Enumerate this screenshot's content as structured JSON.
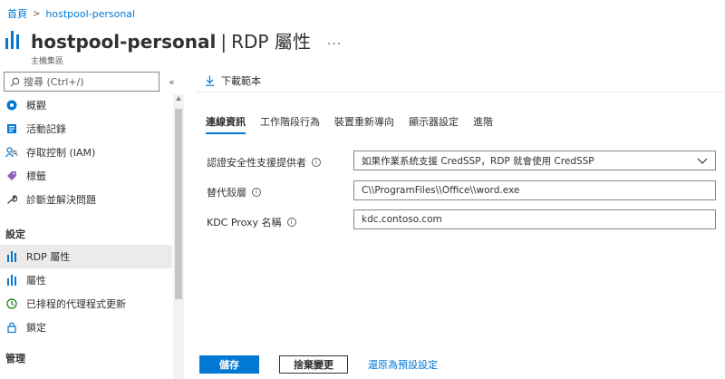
{
  "breadcrumb": {
    "home": "首頁",
    "current": "hostpool-personal"
  },
  "header": {
    "resource_name": "hostpool-personal",
    "separator": "|",
    "blade_title": "RDP 屬性",
    "more": "···",
    "subtitle": "主機集區"
  },
  "sidebar": {
    "search_placeholder": "搜尋 (Ctrl+/)",
    "collapse": "«",
    "items_top": [
      {
        "label": "概觀",
        "icon": "overview-icon"
      },
      {
        "label": "活動記錄",
        "icon": "activity-log-icon"
      },
      {
        "label": "存取控制 (IAM)",
        "icon": "iam-icon"
      },
      {
        "label": "標籤",
        "icon": "tag-icon"
      },
      {
        "label": "診斷並解決問題",
        "icon": "wrench-icon"
      }
    ],
    "section_settings": "設定",
    "items_settings": [
      {
        "label": "RDP 屬性",
        "icon": "hostpool-icon",
        "active": true
      },
      {
        "label": "屬性",
        "icon": "properties-icon"
      },
      {
        "label": "已排程的代理程式更新",
        "icon": "clock-icon"
      },
      {
        "label": "鎖定",
        "icon": "lock-icon"
      }
    ],
    "section_manage": "管理"
  },
  "toolbar": {
    "download_label": "下載範本"
  },
  "tabs": [
    {
      "label": "連線資訊",
      "active": true
    },
    {
      "label": "工作階段行為"
    },
    {
      "label": "裝置重新導向"
    },
    {
      "label": "顯示器設定"
    },
    {
      "label": "進階"
    }
  ],
  "form": {
    "credssp_label": "認證安全性支援提供者",
    "credssp_value": "如果作業系統支援 CredSSP，RDP 就會使用 CredSSP",
    "shell_label": "替代殼層",
    "shell_value": "C\\\\ProgramFiles\\\\Office\\\\word.exe",
    "kdc_label": "KDC Proxy 名稱",
    "kdc_value": "kdc.contoso.com"
  },
  "footer": {
    "save_label": "儲存",
    "discard_label": "捨棄變更",
    "reset_label": "還原為預設設定"
  },
  "colors": {
    "accent": "#0078d4"
  }
}
